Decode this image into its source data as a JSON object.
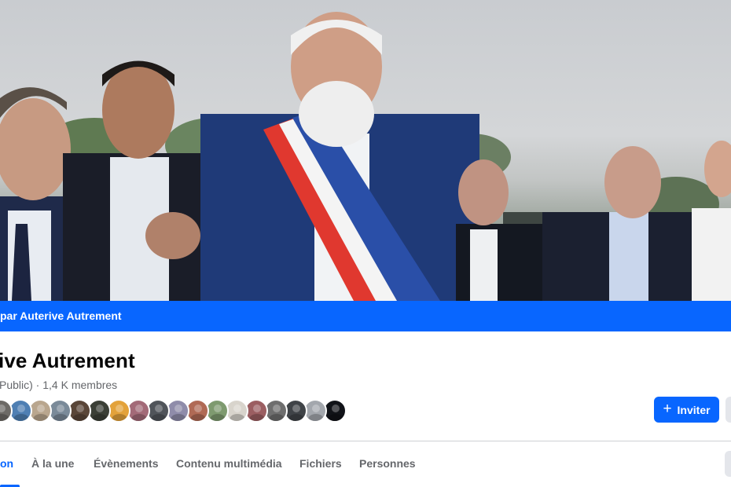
{
  "cover": {
    "description_alt": "Photo de couverture du groupe"
  },
  "banner": {
    "text": "par Auterive Autrement"
  },
  "group": {
    "name": "ive Autrement",
    "privacy": "Public)",
    "separator": " · ",
    "members": "1,4 K membres"
  },
  "members_preview": {
    "colors": [
      "#6d6a66",
      "#4f7fb3",
      "#b9a68e",
      "#7a8a99",
      "#5a4638",
      "#3b3f36",
      "#e3a23a",
      "#a36a78",
      "#50545a",
      "#8f8caa",
      "#b06a55",
      "#7e9a6f",
      "#d8d4cc",
      "#9b5e61",
      "#6e6e6e",
      "#3f4347",
      "#a3a7ad",
      "#111318"
    ]
  },
  "actions": {
    "invite_label": "Inviter",
    "invite_icon": "plus-icon"
  },
  "tabs": [
    {
      "label": "on",
      "active": true
    },
    {
      "label": "À la une",
      "active": false
    },
    {
      "label": "Évènements",
      "active": false
    },
    {
      "label": "Contenu multimédia",
      "active": false
    },
    {
      "label": "Fichiers",
      "active": false
    },
    {
      "label": "Personnes",
      "active": false
    }
  ],
  "colors": {
    "accent": "#0866ff",
    "secondary_text": "#65676b",
    "button_grey": "#e4e6eb"
  }
}
